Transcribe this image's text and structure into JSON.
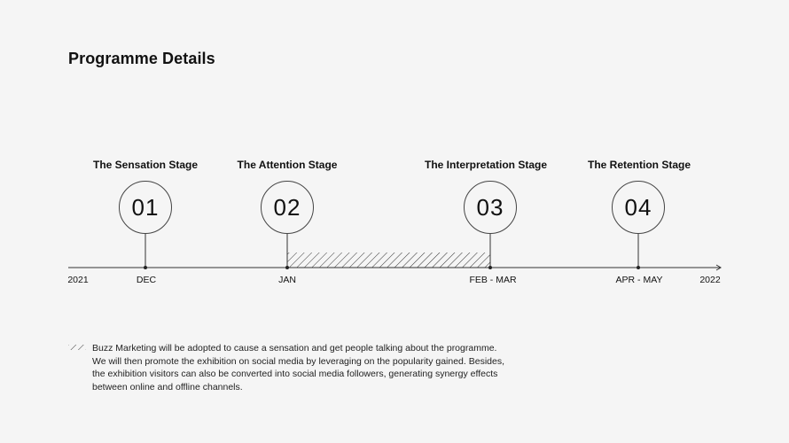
{
  "page_title": "Programme Details",
  "stages": [
    {
      "title": "The Sensation Stage",
      "number": "01"
    },
    {
      "title": "The Attention Stage",
      "number": "02"
    },
    {
      "title": "The Interpretation Stage",
      "number": "03"
    },
    {
      "title": "The Retention Stage",
      "number": "04"
    }
  ],
  "axis": {
    "start": "2021",
    "end": "2022",
    "ticks": [
      "DEC",
      "JAN",
      "FEB - MAR",
      "APR - MAY"
    ]
  },
  "legend": {
    "text": "Buzz Marketing will be adopted to cause a sensation and get people talking about the programme. We will then promote the exhibition on social media by leveraging on the popularity gained. Besides, the exhibition visitors can also be converted into social media followers, generating synergy effects between online and offline channels."
  }
}
